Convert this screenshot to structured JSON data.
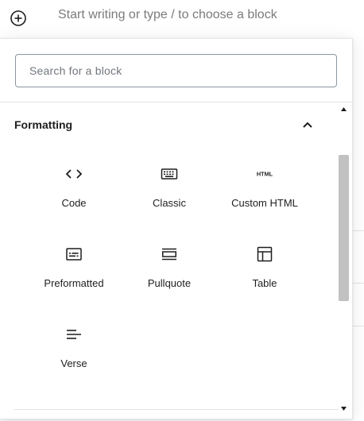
{
  "editor": {
    "placeholder": "Start writing or type / to choose a block",
    "inserter_icon": "plus-circle-icon"
  },
  "inserter": {
    "search": {
      "placeholder": "Search for a block",
      "value": ""
    },
    "panel": {
      "title": "Formatting",
      "state": "expanded",
      "blocks": [
        {
          "label": "Code",
          "icon": "code-icon"
        },
        {
          "label": "Classic",
          "icon": "keyboard-icon"
        },
        {
          "label": "Custom HTML",
          "icon": "html-icon"
        },
        {
          "label": "Preformatted",
          "icon": "preformatted-icon"
        },
        {
          "label": "Pullquote",
          "icon": "pullquote-icon"
        },
        {
          "label": "Table",
          "icon": "table-icon"
        },
        {
          "label": "Verse",
          "icon": "verse-icon"
        }
      ]
    }
  },
  "colors": {
    "text": "#1e1e1e",
    "placeholder": "#7b7b7b",
    "border": "#8d96a0",
    "divider": "#e2e4e7",
    "scroll_thumb": "#c1c1c1"
  }
}
